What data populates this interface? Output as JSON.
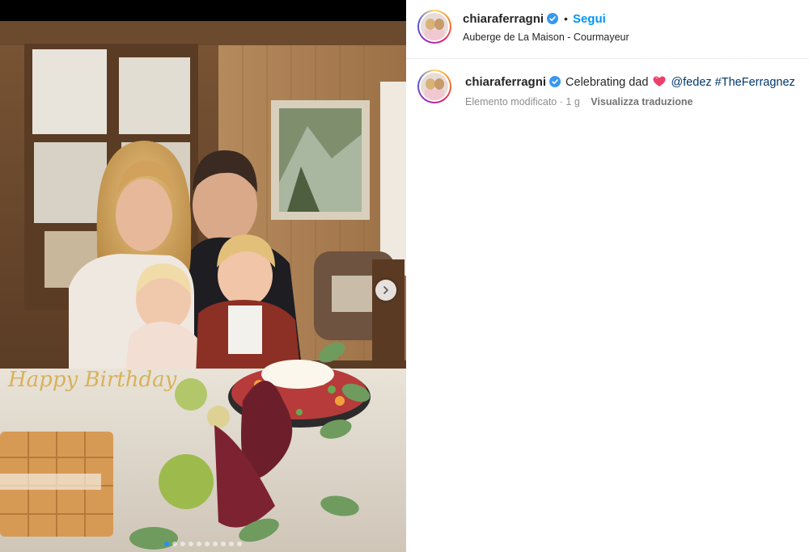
{
  "post": {
    "username": "chiaraferragni",
    "follow_label": "Segui",
    "separator": "•",
    "location": "Auberge de La Maison - Courmayeur",
    "caption": {
      "text": "Celebrating dad",
      "mention": "@fedez",
      "hashtag": "#TheFerragnez"
    },
    "edited_label": "Elemento modificato",
    "time_sep": "·",
    "time_ago": "1 g",
    "translate_label": "Visualizza traduzione"
  },
  "media": {
    "cake_topper_text": "Happy Birthday",
    "carousel_count": 10,
    "carousel_active_index": 0
  },
  "colors": {
    "follow_blue": "#0095f6",
    "link_blue": "#00376b",
    "verified_blue": "#3897f0",
    "meta_gray": "#8e8e8e"
  },
  "icons": {
    "verified": "verified-badge-icon",
    "heart": "heart-emoji-icon",
    "next": "chevron-right-icon"
  }
}
